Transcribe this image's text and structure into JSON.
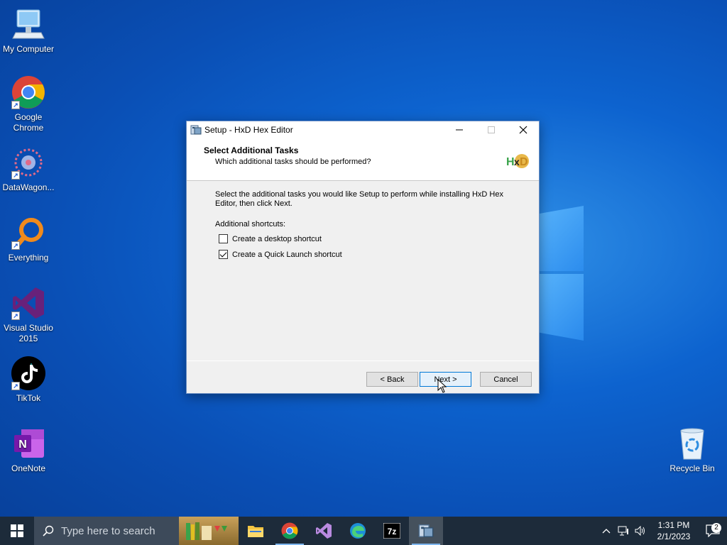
{
  "desktop": {
    "icons": [
      {
        "label": "My Computer"
      },
      {
        "label": "Google Chrome"
      },
      {
        "label": "DataWagon..."
      },
      {
        "label": "Everything"
      },
      {
        "label": "Visual Studio 2015"
      },
      {
        "label": "TikTok"
      },
      {
        "label": "OneNote"
      },
      {
        "label": "Recycle Bin"
      }
    ]
  },
  "dialog": {
    "title": "Setup - HxD Hex Editor",
    "header_title": "Select Additional Tasks",
    "header_subtitle": "Which additional tasks should be performed?",
    "description": "Select the additional tasks you would like Setup to perform while installing HxD Hex Editor, then click Next.",
    "section_label": "Additional shortcuts:",
    "tasks": [
      {
        "label": "Create a desktop shortcut",
        "checked": false
      },
      {
        "label": "Create a Quick Launch shortcut",
        "checked": true
      }
    ],
    "buttons": {
      "back": "< Back",
      "next": "Next >",
      "cancel": "Cancel"
    }
  },
  "taskbar": {
    "search_placeholder": "Type here to search",
    "time": "1:31 PM",
    "date": "2/1/2023",
    "notification_count": "2"
  },
  "colors": {
    "accent": "#0078d7",
    "taskbar": "#1d2b3a"
  }
}
